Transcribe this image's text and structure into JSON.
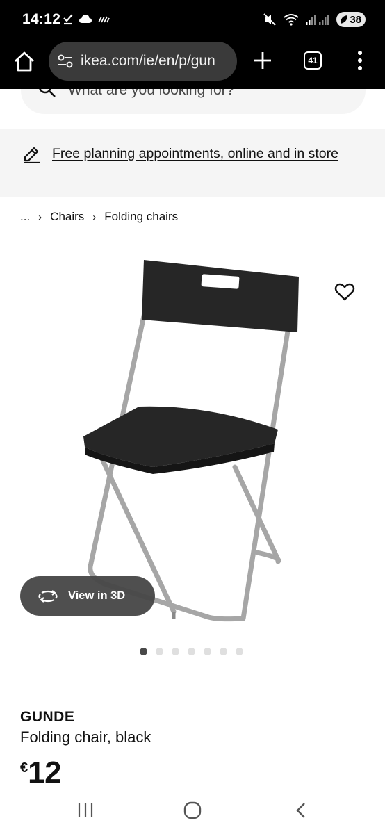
{
  "status_bar": {
    "time": "14:12",
    "battery_level": "38",
    "icons": [
      "download-done-icon",
      "cloud-icon",
      "signal-bars-icon",
      "mute-icon",
      "wifi-icon",
      "cell-signal-icon",
      "battery-saver-icon"
    ]
  },
  "browser": {
    "url": "ikea.com/ie/en/p/gun",
    "tab_count": "41"
  },
  "search": {
    "placeholder": "What are you looking for?"
  },
  "promo": {
    "link_text": "Free planning appointments, online and in store"
  },
  "breadcrumb": {
    "ellipsis": "...",
    "items": [
      "Chairs",
      "Folding chairs"
    ]
  },
  "product": {
    "view_3d_label": "View in 3D",
    "carousel_total": 7,
    "carousel_active_index": 0,
    "name": "GUNDE",
    "description": "Folding chair, black",
    "currency": "€",
    "price": "12",
    "colors": {
      "chair_body": "#262626",
      "frame": "#a6a6a6"
    }
  }
}
